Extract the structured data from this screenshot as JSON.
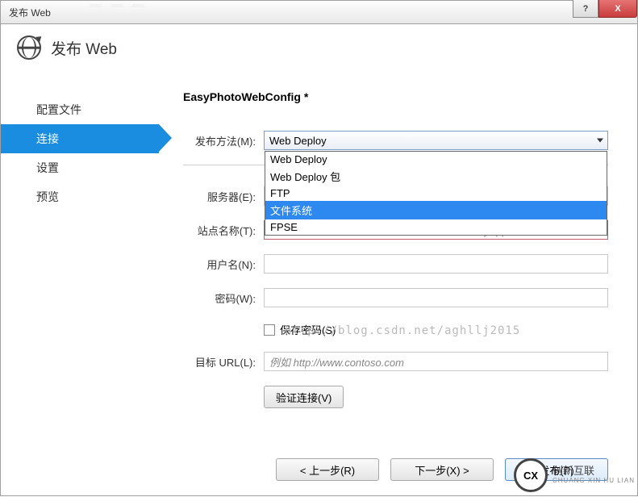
{
  "title": "发布 Web",
  "titlebar_help": "?",
  "titlebar_close": "X",
  "header_title": "发布 Web",
  "sidebar": {
    "items": [
      {
        "label": "配置文件"
      },
      {
        "label": "连接"
      },
      {
        "label": "设置"
      },
      {
        "label": "预览"
      }
    ]
  },
  "profile_name": "EasyPhotoWebConfig *",
  "labels": {
    "method": "发布方法(M):",
    "server": "服务器(E):",
    "site": "站点名称(T):",
    "user": "用户名(N):",
    "password": "密码(W):",
    "save_pwd": "保存密码(S)",
    "dest": "目标 URL(L):",
    "validate": "验证连接(V)"
  },
  "combo": {
    "selected": "Web Deploy",
    "options": [
      "Web Deploy",
      "Web Deploy 包",
      "FTP",
      "文件系统",
      "FPSE"
    ],
    "highlight_index": 3
  },
  "placeholders": {
    "site": "例如 www.contoso.com 或 Default Web Site/MyApp",
    "dest": "例如 http://www.contoso.com"
  },
  "footer": {
    "prev": "< 上一步(R)",
    "next": "下一步(X) >",
    "publish": "发布(P)"
  },
  "watermark": "http://blog.csdn.net/aghllj2015",
  "brand": {
    "main": "创新互联",
    "sub": "CHUANG XIN HU LIAN",
    "circ": "CX"
  }
}
